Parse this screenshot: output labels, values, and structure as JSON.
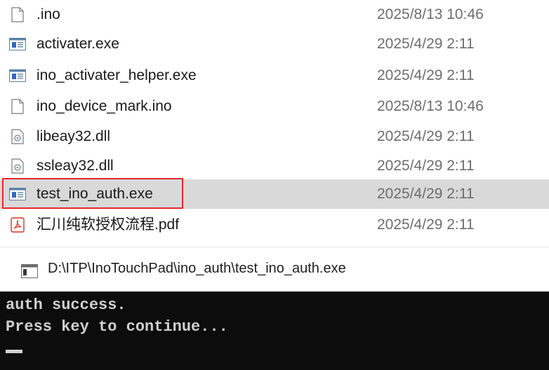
{
  "explorer": {
    "files": [
      {
        "name": ".ino",
        "modified": "2025/8/13 10:46",
        "icon": "generic-file-icon"
      },
      {
        "name": "activater.exe",
        "modified": "2025/4/29 2:11",
        "icon": "exe-file-icon"
      },
      {
        "name": "ino_activater_helper.exe",
        "modified": "2025/4/29 2:11",
        "icon": "exe-file-icon"
      },
      {
        "name": "ino_device_mark.ino",
        "modified": "2025/8/13 10:46",
        "icon": "generic-file-icon"
      },
      {
        "name": "libeay32.dll",
        "modified": "2025/4/29 2:11",
        "icon": "dll-file-icon"
      },
      {
        "name": "ssleay32.dll",
        "modified": "2025/4/29 2:11",
        "icon": "dll-file-icon"
      },
      {
        "name": "test_ino_auth.exe",
        "modified": "2025/4/29 2:11",
        "icon": "exe-file-icon",
        "selected": true
      },
      {
        "name": "汇川纯软授权流程.pdf",
        "modified": "2025/4/29 2:11",
        "icon": "pdf-file-icon"
      }
    ],
    "highlight_color": "#e8262a",
    "selection_color": "#d9d9d9"
  },
  "console": {
    "title": "D:\\ITP\\InoTouchPad\\ino_auth\\test_ino_auth.exe",
    "lines": [
      "auth success.",
      "Press key to continue..."
    ],
    "background": "#0c0c0c",
    "text_color": "#d0d0d0"
  }
}
